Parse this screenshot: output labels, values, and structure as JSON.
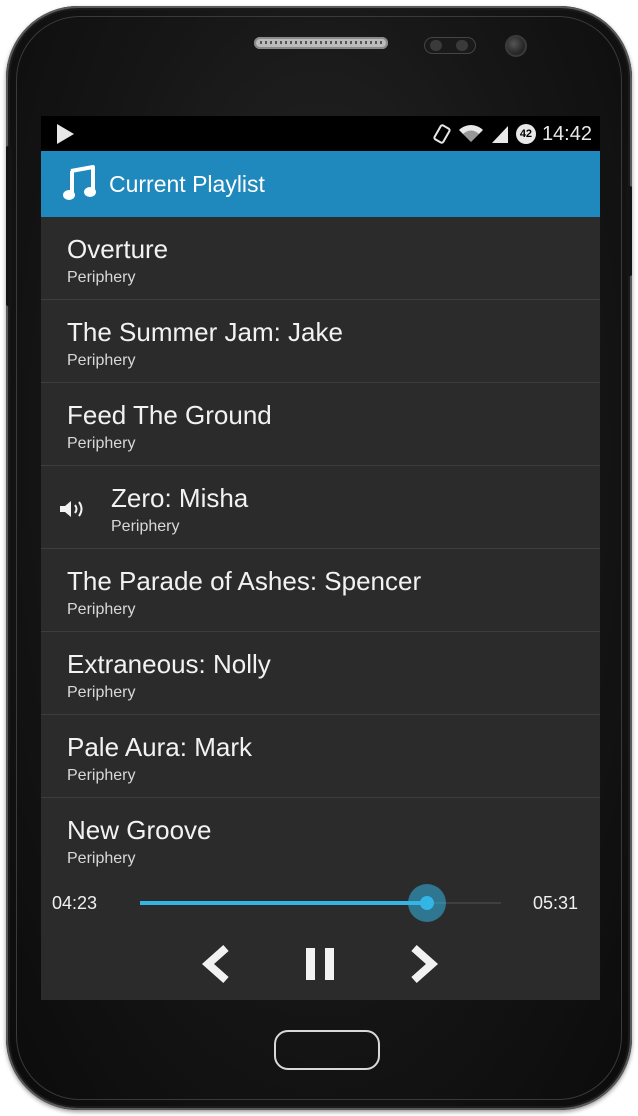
{
  "status_bar": {
    "time": "14:42",
    "battery_level": "42"
  },
  "app_bar": {
    "title": "Current Playlist",
    "icon": "music-note-icon"
  },
  "playlist": [
    {
      "song": "Overture",
      "artist": "Periphery",
      "playing": false
    },
    {
      "song": "The Summer Jam: Jake",
      "artist": "Periphery",
      "playing": false
    },
    {
      "song": "Feed The Ground",
      "artist": "Periphery",
      "playing": false
    },
    {
      "song": "Zero: Misha",
      "artist": "Periphery",
      "playing": true
    },
    {
      "song": "The Parade of Ashes: Spencer",
      "artist": "Periphery",
      "playing": false
    },
    {
      "song": "Extraneous: Nolly",
      "artist": "Periphery",
      "playing": false
    },
    {
      "song": "Pale Aura: Mark",
      "artist": "Periphery",
      "playing": false
    },
    {
      "song": "New Groove",
      "artist": "Periphery",
      "playing": false
    }
  ],
  "player": {
    "elapsed": "04:23",
    "total": "05:31",
    "progress": 0.796,
    "controls": [
      "previous-icon",
      "pause-icon",
      "next-icon"
    ]
  },
  "colors": {
    "accent": "#1f88bc",
    "progress": "#33b5e5",
    "background": "#2b2b2b"
  }
}
